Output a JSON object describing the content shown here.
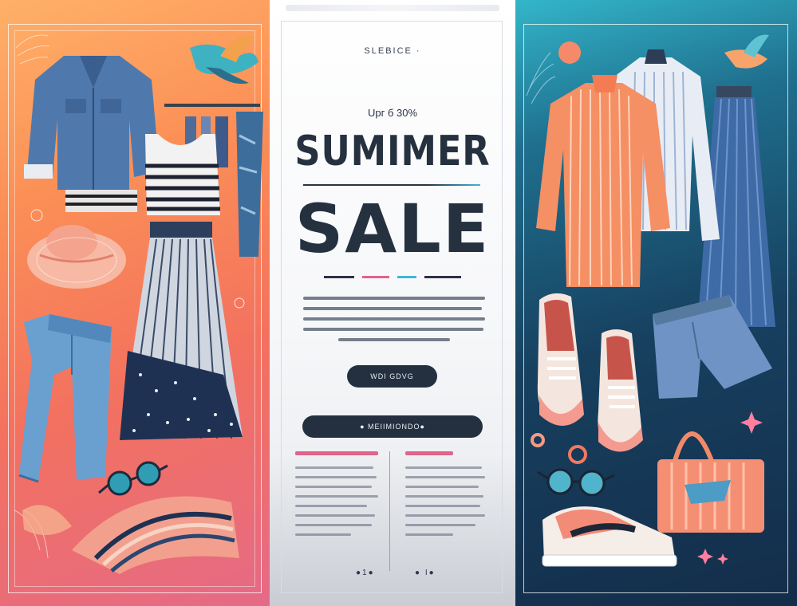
{
  "poster": {
    "kicker": "SLEBICE ·",
    "upto": "Upг б 30%",
    "title": "SUMIMER",
    "sale": "SALE",
    "cta_primary": "WDI GDVG",
    "cta_secondary": "● MEIIMIONDO●",
    "footer_left": "●1●",
    "footer_right": "● I●"
  },
  "colors": {
    "left_panel": "#f5825a",
    "right_panel": "#173d5c",
    "ink": "#263140",
    "accent_pink": "#e0648a",
    "accent_cyan": "#3fb7d6"
  },
  "icons": {
    "left": [
      "denim-jacket-icon",
      "striped-top-icon",
      "pleated-skirt-icon",
      "sun-hat-icon",
      "jeans-icon",
      "sunglasses-icon",
      "clothes-rack-icon",
      "bird-icon",
      "wave-decoration-icon"
    ],
    "right": [
      "striped-shirt-icon",
      "white-shirt-icon",
      "pleated-trousers-icon",
      "sneakers-icon",
      "denim-shorts-icon",
      "tote-bag-icon",
      "sneaker-icon",
      "sunglasses-icon",
      "sun-icon",
      "bird-icon"
    ]
  }
}
